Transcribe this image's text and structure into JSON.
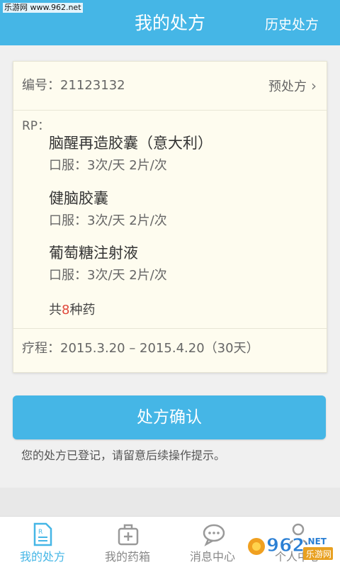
{
  "watermark": "乐游网 www.962.net",
  "header": {
    "title": "我的处方",
    "history_label": "历史处方"
  },
  "prescription": {
    "id_label": "编号：",
    "id_value": "21123132",
    "type_label": "预处方",
    "rp_label": "RP：",
    "medicines": [
      {
        "name": "脑醒再造胶囊（意大利）",
        "dosage": "口服：3次/天  2片/次"
      },
      {
        "name": "健脑胶囊",
        "dosage": "口服：3次/天  2片/次"
      },
      {
        "name": "葡萄糖注射液",
        "dosage": "口服：3次/天  2片/次"
      }
    ],
    "total_prefix": "共",
    "total_count": "8",
    "total_suffix": "种药",
    "course_label": "疗程：",
    "course_value": "2015.3.20 – 2015.4.20（30天）"
  },
  "confirm_label": "处方确认",
  "notice": "您的处方已登记，请留意后续操作提示。",
  "tabs": [
    {
      "label": "我的处方",
      "icon": "prescription-icon",
      "active": true
    },
    {
      "label": "我的药箱",
      "icon": "medicine-box-icon",
      "active": false
    },
    {
      "label": "消息中心",
      "icon": "chat-icon",
      "active": false
    },
    {
      "label": "个人中心",
      "icon": "person-icon",
      "active": false
    }
  ],
  "colors": {
    "accent": "#45b6e6",
    "card_bg": "#fefcef",
    "highlight": "#e0483b"
  },
  "logo": {
    "text": "962",
    "tld": ".NET",
    "cn": "乐游网"
  }
}
